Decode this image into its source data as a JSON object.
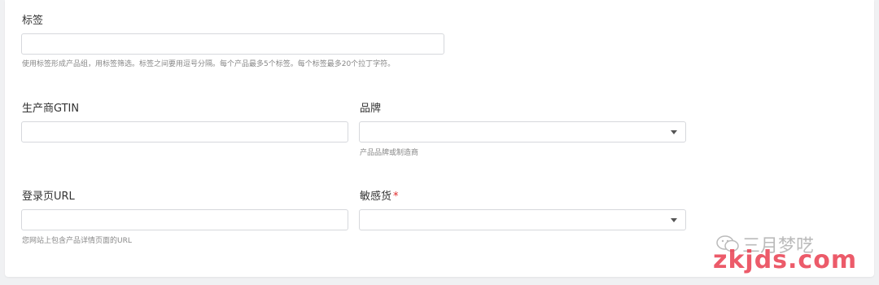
{
  "form": {
    "tags": {
      "label": "标签",
      "value": "",
      "help": "使用标签形成产品组，用标签筛选。标签之间要用逗号分隔。每个产品最多5个标签。每个标签最多20个拉丁字符。"
    },
    "gtin": {
      "label": "生产商GTIN",
      "value": ""
    },
    "brand": {
      "label": "品牌",
      "selected": "",
      "help": "产品品牌或制造商"
    },
    "landing_url": {
      "label": "登录页URL",
      "value": "",
      "help": "您网站上包含产品详情页面的URL"
    },
    "sensitive": {
      "label": "敏感货",
      "required_mark": "*",
      "selected": ""
    }
  },
  "watermark": {
    "brand": "三月梦呓",
    "site": "zkjds.com",
    "icon": "wechat-icon"
  },
  "colors": {
    "required": "#e02b2b",
    "border": "#d6d8dc",
    "help_text": "#888888"
  }
}
